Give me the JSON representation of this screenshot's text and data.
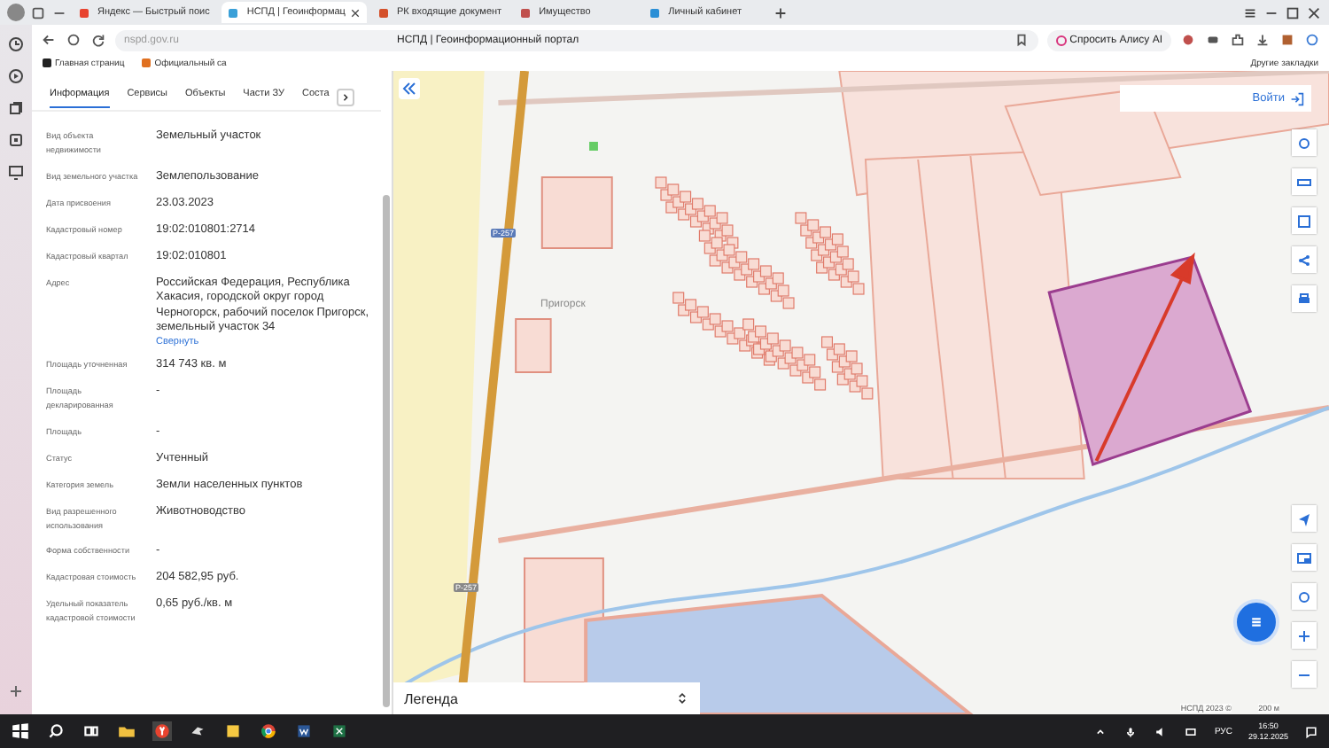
{
  "browser": {
    "tabs": [
      {
        "title": "Яндекс — Быстрый поис",
        "selected": false
      },
      {
        "title": "НСПД | Геоинформац",
        "selected": true
      },
      {
        "title": "РК входящие документ",
        "selected": false
      },
      {
        "title": "Имущество",
        "selected": false
      },
      {
        "title": "Личный кабинет",
        "selected": false
      }
    ],
    "address": "nspd.gov.ru",
    "page_title": "НСПД | Геоинформационный портал",
    "alice_button": "Спросить Алису AI",
    "bookmarks": [
      "Главная страниц",
      "Официальный са"
    ],
    "other_bookmarks": "Другие закладки"
  },
  "panel": {
    "tabs": [
      {
        "label": "Информация",
        "selected": true
      },
      {
        "label": "Сервисы",
        "selected": false
      },
      {
        "label": "Объекты",
        "selected": false
      },
      {
        "label": "Части ЗУ",
        "selected": false
      },
      {
        "label": "Соста",
        "selected": false
      }
    ],
    "fields": [
      {
        "label": "Вид объекта недвижимости",
        "value": "Земельный участок"
      },
      {
        "label": "Вид земельного участка",
        "value": "Землепользование"
      },
      {
        "label": "Дата присвоения",
        "value": "23.03.2023"
      },
      {
        "label": "Кадастровый номер",
        "value": "19:02:010801:2714"
      },
      {
        "label": "Кадастровый квартал",
        "value": "19:02:010801"
      },
      {
        "label": "Адрес",
        "value": "Российская Федерация, Республика Хакасия, городской округ город Черногорск, рабочий поселок Пригорск, земельный участок 34",
        "link": "Свернуть"
      },
      {
        "label": "Площадь уточненная",
        "value": "314 743 кв. м"
      },
      {
        "label": "Площадь декларированная",
        "value": "-"
      },
      {
        "label": "Площадь",
        "value": "-"
      },
      {
        "label": "Статус",
        "value": "Учтенный"
      },
      {
        "label": "Категория земель",
        "value": "Земли населенных пунктов"
      },
      {
        "label": "Вид разрешенного использования",
        "value": "Животноводство"
      },
      {
        "label": "Форма собственности",
        "value": "-"
      },
      {
        "label": "Кадастровая стоимость",
        "value": "204 582,95 руб."
      },
      {
        "label": "Удельный показатель кадастровой стоимости",
        "value": "0,65 руб./кв. м"
      }
    ]
  },
  "map": {
    "place_label": "Пригорск",
    "road_shields": [
      "Р-257",
      "Р-257"
    ],
    "login": "Войти",
    "legend": "Легенда",
    "attribution": "НСПД 2023 ©",
    "scale": "200 м"
  },
  "taskbar": {
    "language": "РУС",
    "time": "16:50",
    "date": "29.12.2025"
  }
}
